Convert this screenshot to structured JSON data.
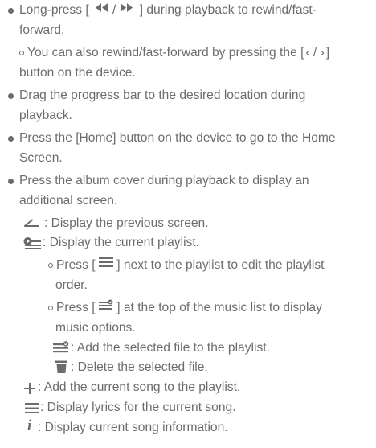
{
  "bullets": {
    "rewind": {
      "line1_a": "Long-press [ ",
      "line1_b": " ] during playback to rewind/fast-",
      "line2": "forward.",
      "sub": {
        "line1_a": "You can also rewind/fast-forward by pressing the [",
        "line1_b": "]",
        "line2": "button on the device."
      }
    },
    "progress": {
      "line1": "Drag the progress bar to the desired location during",
      "line2": "playback."
    },
    "home": {
      "line1": "Press the [Home] button on the device to go to the Home",
      "line2": "Screen."
    },
    "album": {
      "line1": "Press the album cover during playback to display an",
      "line2": "additional screen."
    }
  },
  "icons_list": {
    "back": ": Display the previous screen.",
    "playlist": ": Display the current playlist.",
    "playlist_sub1": {
      "line1_a": "Press [ ",
      "line1_b": " ] next to the playlist to edit the playlist",
      "line2": "order."
    },
    "playlist_sub2": {
      "line1_a": "Press [ ",
      "line1_b": " ] at the top of the music list to display",
      "line2": "music options."
    },
    "add_selected": ": Add the selected file to the playlist.",
    "delete_selected": ": Delete the selected file.",
    "add_current": ": Add the current song to the playlist.",
    "lyrics": ": Display lyrics for the current song.",
    "info": ": Display current song information."
  },
  "symbols": {
    "seek": "/",
    "device_seek": "‹ / ›",
    "info_glyph": "i"
  },
  "colors": {
    "text": "#6a6c6f"
  }
}
